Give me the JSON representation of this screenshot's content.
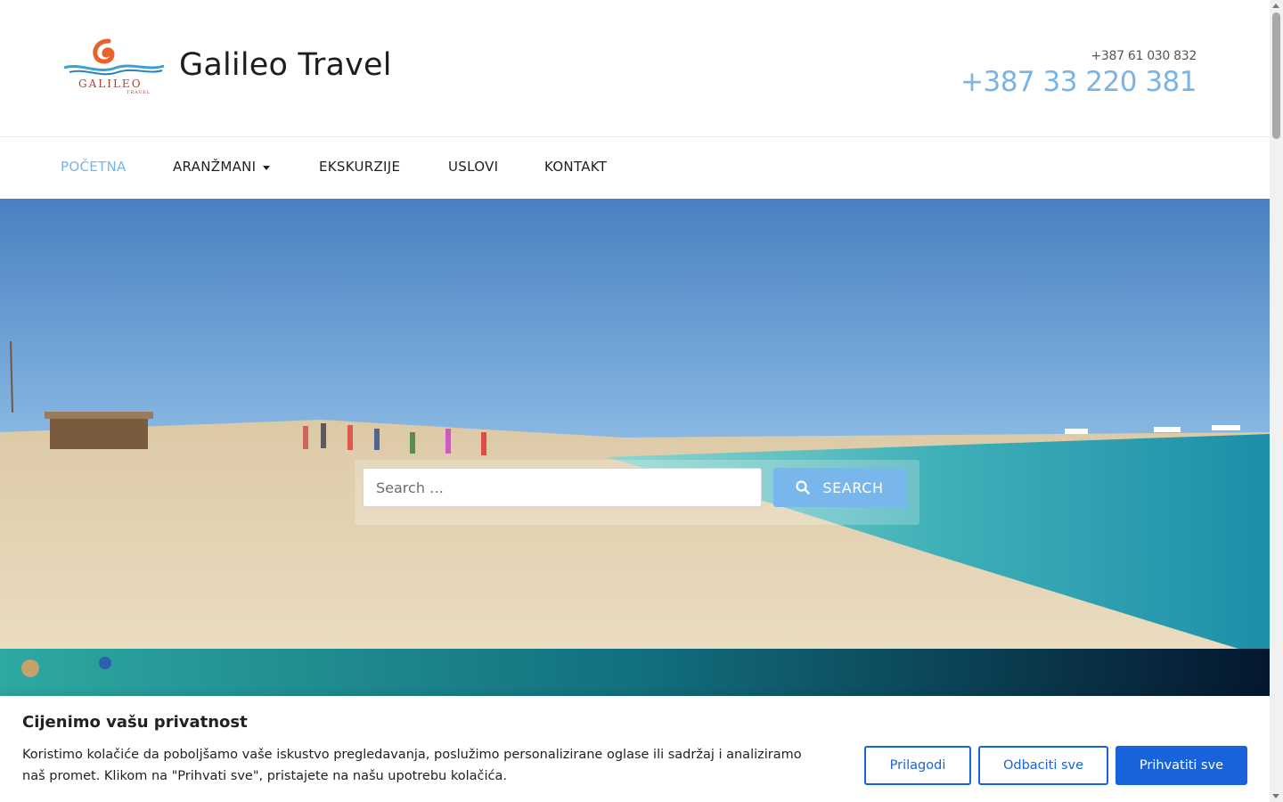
{
  "header": {
    "site_title": "Galileo Travel",
    "logo_text": "GALILEO",
    "logo_subtext": "TRAVEL",
    "phone_secondary": "+387 61 030 832",
    "phone_primary": "+387 33 220 381"
  },
  "nav": {
    "items": [
      {
        "label": "POČETNA",
        "active": true
      },
      {
        "label": "ARANŽMANI",
        "has_dropdown": true
      },
      {
        "label": "EKSKURZIJE"
      },
      {
        "label": "USLOVI"
      },
      {
        "label": "KONTAKT"
      }
    ]
  },
  "search": {
    "placeholder": "Search …",
    "button_label": "SEARCH",
    "button_icon": "search-icon"
  },
  "cookie": {
    "title": "Cijenimo vašu privatnost",
    "text": "Koristimo kolačiće da poboljšamo vaše iskustvo pregledavanja, poslužimo personalizirane oglase ili sadržaj i analiziramo naš promet. Klikom na \"Prihvati sve\", pristajete na našu upotrebu kolačića.",
    "customize_label": "Prilagodi",
    "reject_label": "Odbaciti sve",
    "accept_label": "Prihvatiti sve"
  },
  "colors": {
    "accent": "#78b4e6",
    "button": "#79b6ec",
    "cookie_primary": "#1863dc"
  }
}
